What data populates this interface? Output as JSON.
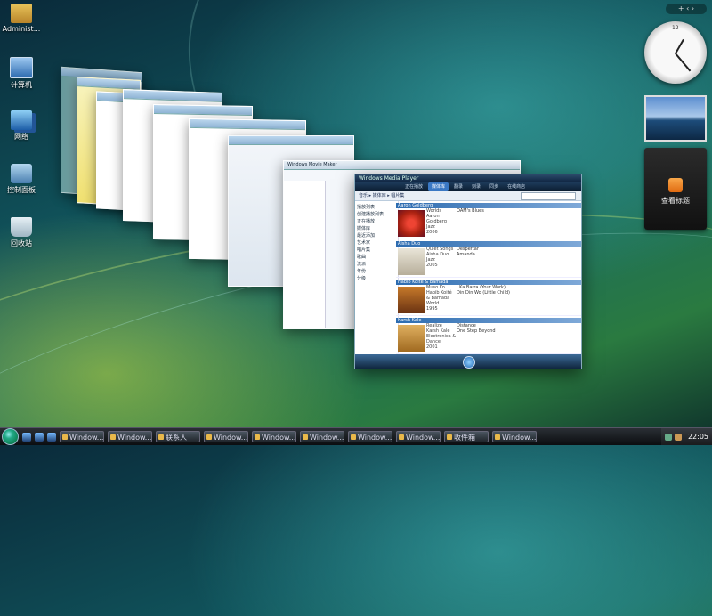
{
  "desktop": {
    "icons": [
      {
        "label": "Administ...",
        "icon": "user-folder-icon"
      },
      {
        "label": "计算机",
        "icon": "computer-icon"
      },
      {
        "label": "网络",
        "icon": "network-icon"
      },
      {
        "label": "控制面板",
        "icon": "control-panel-icon"
      },
      {
        "label": "回收站",
        "icon": "recycle-bin-icon"
      }
    ]
  },
  "flip3d": {
    "windows": [
      {
        "title": "Windows Movie Maker"
      },
      {
        "title": "Windows Media Player"
      }
    ],
    "media_player": {
      "tabs": [
        "正在播放",
        "媒体库",
        "翻录",
        "刻录",
        "同步",
        "在线商店"
      ],
      "breadcrumb": "音乐 ▸ 媒体库 ▸ 唱片集",
      "nav": [
        "播放列表",
        "创建播放列表",
        "正在播放",
        "媒体库",
        "最近添加",
        "艺术家",
        "唱片集",
        "歌曲",
        "流派",
        "年份",
        "分级"
      ],
      "albums": [
        {
          "group": "Aaron Goldberg",
          "title": "Worlds",
          "artist": "Aaron Goldberg",
          "genre": "Jazz",
          "year": "2006",
          "tracks": [
            "OAM's Blues"
          ]
        },
        {
          "group": "Aisha Duo",
          "title": "Quiet Songs",
          "artist": "Aisha Duo",
          "genre": "Jazz",
          "year": "2005",
          "tracks": [
            "Despertar",
            "Amanda"
          ]
        },
        {
          "group": "Habib Koité & Bamada",
          "title": "Muso Ko",
          "artist": "Habib Koité & Bamada",
          "genre": "World",
          "year": "1995",
          "tracks": [
            "I Ka Barra (Your Work)",
            "Din Din Wo (Little Child)"
          ]
        },
        {
          "group": "Karsh Kale",
          "title": "Realize",
          "artist": "Karsh Kale",
          "genre": "Electronica & Dance",
          "year": "2001",
          "tracks": [
            "Distance",
            "One Step Beyond"
          ]
        }
      ]
    }
  },
  "sidebar": {
    "controls": "+ ‹ ›",
    "feed_label": "查看标题"
  },
  "taskbar": {
    "buttons": [
      "Window...",
      "Window...",
      "联系人",
      "Window...",
      "Window...",
      "Window...",
      "Window...",
      "Window...",
      "收件箱",
      "Window..."
    ],
    "time": "22:05"
  }
}
